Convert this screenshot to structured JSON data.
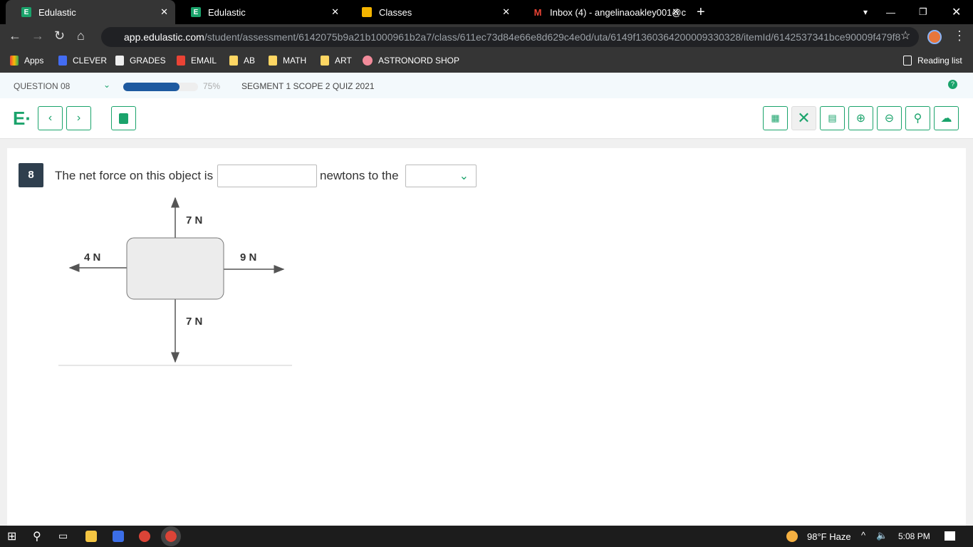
{
  "browser": {
    "tabs": [
      {
        "title": "Edulastic",
        "active": true
      },
      {
        "title": "Edulastic"
      },
      {
        "title": "Classes"
      },
      {
        "title": "Inbox (4) - angelinaoakley001@c"
      }
    ],
    "url_domain": "app.edulastic.com",
    "url_path": "/student/assessment/6142075b9a21b1000961b2a7/class/611ec73d84e66e8d629c4e0d/uta/6149f1360364200009330328/itemId/6142537341bce90009f479f8",
    "bookmarks": [
      "Apps",
      "CLEVER",
      "GRADES",
      "EMAIL",
      "AB",
      "MATH",
      "ART",
      "ASTRONORD SHOP"
    ],
    "reading_list": "Reading list"
  },
  "quiz": {
    "question_label": "QUESTION 08",
    "progress_percent": 75,
    "progress_text": "75%",
    "title": "SEGMENT 1 SCOPE 2 QUIZ 2021"
  },
  "question": {
    "number": "8",
    "text_before": "The net force on this object is",
    "text_after": "newtons to the",
    "input_value": "",
    "dropdown_value": ""
  },
  "diagram": {
    "up": "7 N",
    "down": "7 N",
    "left": "4 N",
    "right": "9 N"
  },
  "taskbar": {
    "weather": "98°F  Haze",
    "time": "5:08 PM"
  }
}
